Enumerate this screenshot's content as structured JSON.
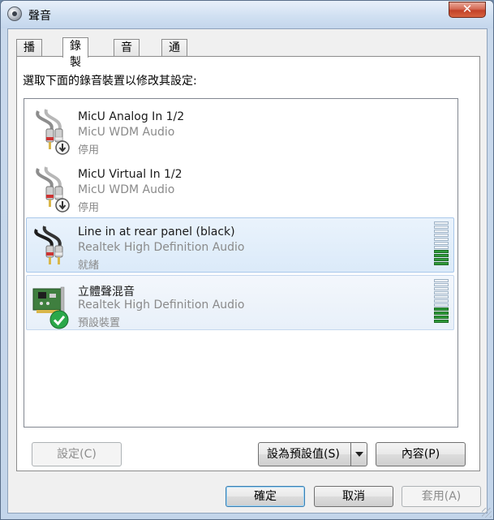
{
  "window": {
    "title": "聲音",
    "close_symbol": "✕"
  },
  "tabs": [
    {
      "label": "播放"
    },
    {
      "label": "錄製"
    },
    {
      "label": "音效"
    },
    {
      "label": "通訊"
    }
  ],
  "instruction": "選取下面的錄音裝置以修改其設定:",
  "devices": [
    {
      "name": "MicU Analog In 1/2",
      "driver": "MicU WDM Audio",
      "status": "停用",
      "icon": "rca-cable-icon",
      "badge": "disabled-arrow-badge",
      "level": 0
    },
    {
      "name": "MicU Virtual In 1/2",
      "driver": "MicU WDM Audio",
      "status": "停用",
      "icon": "rca-cable-icon",
      "badge": "disabled-arrow-badge",
      "level": 0
    },
    {
      "name": "Line in at rear panel (black)",
      "driver": "Realtek High Definition Audio",
      "status": "就緒",
      "icon": "rca-cable-black-icon",
      "badge": "",
      "level": 0.4
    },
    {
      "name": "立體聲混音",
      "driver": "Realtek High Definition Audio",
      "status": "預設裝置",
      "icon": "sound-card-icon",
      "badge": "default-check-badge",
      "level": 0.4
    }
  ],
  "buttons": {
    "configure": "設定(C)",
    "set_default": "設為預設值(S)",
    "properties": "內容(P)",
    "ok": "確定",
    "cancel": "取消",
    "apply": "套用(A)"
  },
  "colors": {
    "selected_fill": "#dbeaf9",
    "meter_on": "#2f9a3a",
    "default_check": "#2aa84a"
  }
}
